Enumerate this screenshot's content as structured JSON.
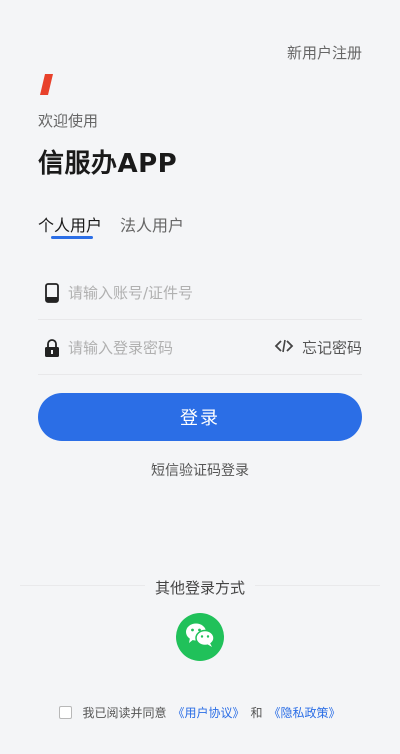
{
  "header": {
    "register_label": "新用户注册"
  },
  "intro": {
    "welcome": "欢迎使用",
    "app_name": "信服办APP"
  },
  "tabs": [
    {
      "label": "个人用户",
      "active": true
    },
    {
      "label": "法人用户",
      "active": false
    }
  ],
  "form": {
    "account_placeholder": "请输入账号/证件号",
    "password_placeholder": "请输入登录密码",
    "forgot_label": "忘记密码",
    "login_label": "登录",
    "sms_login_label": "短信验证码登录"
  },
  "other_login": {
    "title": "其他登录方式",
    "methods": [
      {
        "icon": "wechat-icon"
      }
    ]
  },
  "agreement": {
    "prefix": "我已阅读并同意",
    "user_agreement": "《用户协议》",
    "and": "和",
    "privacy_policy": "《隐私政策》"
  },
  "colors": {
    "accent": "#2b6ee6",
    "brand": "#e8412b",
    "wechat": "#20c15a"
  }
}
